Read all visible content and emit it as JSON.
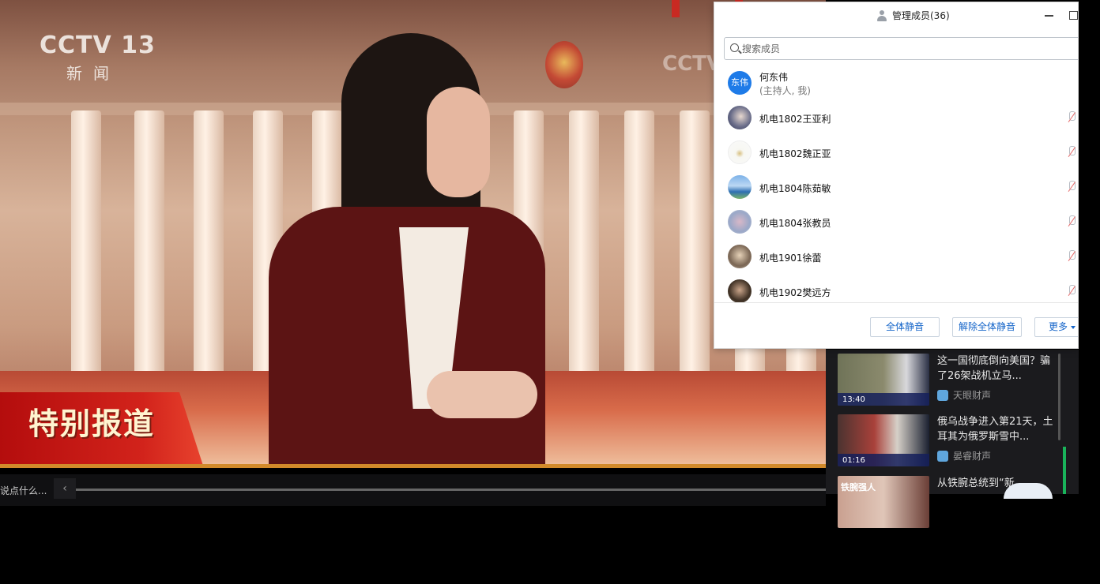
{
  "video": {
    "channel_logo": "CCTV 13",
    "channel_sub": "新闻",
    "ghost_logo": "CCTV",
    "banner_text": "特别报道"
  },
  "control_strip": {
    "comment_placeholder": "说点什么...",
    "collapse_icon": "chevron-left-icon"
  },
  "member_panel": {
    "title": "管理成员(36)",
    "search_placeholder": "搜索成员",
    "host": {
      "avatar_text": "东伟",
      "name": "何东伟",
      "role": "(主持人, 我)",
      "avatar_color": "#1e7be8"
    },
    "members": [
      {
        "name": "机电1802王亚利",
        "mic": "muted"
      },
      {
        "name": "机电1802魏正亚",
        "mic": "muted"
      },
      {
        "name": "机电1804陈茹敏",
        "mic": "muted"
      },
      {
        "name": "机电1804张教员",
        "mic": "muted"
      },
      {
        "name": "机电1901徐蕾",
        "mic": "muted"
      },
      {
        "name": "机电1902樊远方",
        "mic": "muted"
      }
    ],
    "buttons": {
      "mute_all": "全体静音",
      "unmute_all": "解除全体静音",
      "more": "更多"
    },
    "accent_color": "#1565c9"
  },
  "recommended": [
    {
      "title": "这一国彻底倒向美国？骗了26架战机立马...",
      "source": "天眼财声",
      "thumb_time": "13:40"
    },
    {
      "title": "俄乌战争进入第21天，土耳其为俄罗斯雪中...",
      "source": "晏睿财声",
      "thumb_time": "01:16"
    },
    {
      "title": "从铁腕总统到“新",
      "source": "",
      "thumb_tag": "铁腕强人"
    }
  ]
}
